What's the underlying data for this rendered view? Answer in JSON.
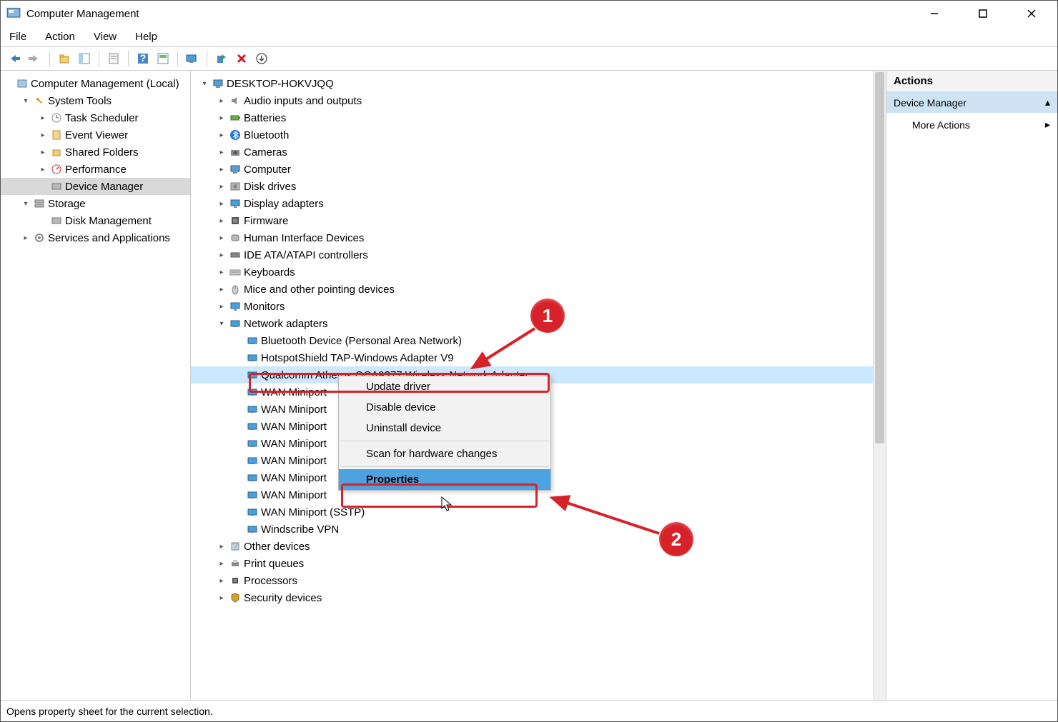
{
  "window": {
    "title": "Computer Management"
  },
  "menubar": [
    "File",
    "Action",
    "View",
    "Help"
  ],
  "left_tree": [
    {
      "indent": 0,
      "exp": "",
      "icon": "mgmt",
      "label": "Computer Management (Local)"
    },
    {
      "indent": 1,
      "exp": "v",
      "icon": "tools",
      "label": "System Tools"
    },
    {
      "indent": 2,
      "exp": ">",
      "icon": "sched",
      "label": "Task Scheduler"
    },
    {
      "indent": 2,
      "exp": ">",
      "icon": "event",
      "label": "Event Viewer"
    },
    {
      "indent": 2,
      "exp": ">",
      "icon": "shared",
      "label": "Shared Folders"
    },
    {
      "indent": 2,
      "exp": ">",
      "icon": "perf",
      "label": "Performance"
    },
    {
      "indent": 2,
      "exp": "",
      "icon": "devmgr",
      "label": "Device Manager",
      "selected": true
    },
    {
      "indent": 1,
      "exp": "v",
      "icon": "storage",
      "label": "Storage"
    },
    {
      "indent": 2,
      "exp": "",
      "icon": "disk",
      "label": "Disk Management"
    },
    {
      "indent": 1,
      "exp": ">",
      "icon": "services",
      "label": "Services and Applications"
    }
  ],
  "center_tree": [
    {
      "indent": 0,
      "exp": "v",
      "icon": "pc",
      "label": "DESKTOP-HOKVJQQ"
    },
    {
      "indent": 1,
      "exp": ">",
      "icon": "audio",
      "label": "Audio inputs and outputs"
    },
    {
      "indent": 1,
      "exp": ">",
      "icon": "battery",
      "label": "Batteries"
    },
    {
      "indent": 1,
      "exp": ">",
      "icon": "bt",
      "label": "Bluetooth"
    },
    {
      "indent": 1,
      "exp": ">",
      "icon": "camera",
      "label": "Cameras"
    },
    {
      "indent": 1,
      "exp": ">",
      "icon": "pc",
      "label": "Computer"
    },
    {
      "indent": 1,
      "exp": ">",
      "icon": "hdd",
      "label": "Disk drives"
    },
    {
      "indent": 1,
      "exp": ">",
      "icon": "display",
      "label": "Display adapters"
    },
    {
      "indent": 1,
      "exp": ">",
      "icon": "fw",
      "label": "Firmware"
    },
    {
      "indent": 1,
      "exp": ">",
      "icon": "hid",
      "label": "Human Interface Devices"
    },
    {
      "indent": 1,
      "exp": ">",
      "icon": "ide",
      "label": "IDE ATA/ATAPI controllers"
    },
    {
      "indent": 1,
      "exp": ">",
      "icon": "kbd",
      "label": "Keyboards"
    },
    {
      "indent": 1,
      "exp": ">",
      "icon": "mouse",
      "label": "Mice and other pointing devices"
    },
    {
      "indent": 1,
      "exp": ">",
      "icon": "display",
      "label": "Monitors"
    },
    {
      "indent": 1,
      "exp": "v",
      "icon": "net",
      "label": "Network adapters"
    },
    {
      "indent": 2,
      "exp": "",
      "icon": "net",
      "label": "Bluetooth Device (Personal Area Network)"
    },
    {
      "indent": 2,
      "exp": "",
      "icon": "net",
      "label": "HotspotShield TAP-Windows Adapter V9"
    },
    {
      "indent": 2,
      "exp": "",
      "icon": "net",
      "label": "Qualcomm Atheros QCA9377 Wireless Network Adapter",
      "hl": true
    },
    {
      "indent": 2,
      "exp": "",
      "icon": "net",
      "label": "WAN Miniport"
    },
    {
      "indent": 2,
      "exp": "",
      "icon": "net",
      "label": "WAN Miniport"
    },
    {
      "indent": 2,
      "exp": "",
      "icon": "net",
      "label": "WAN Miniport"
    },
    {
      "indent": 2,
      "exp": "",
      "icon": "net",
      "label": "WAN Miniport"
    },
    {
      "indent": 2,
      "exp": "",
      "icon": "net",
      "label": "WAN Miniport"
    },
    {
      "indent": 2,
      "exp": "",
      "icon": "net",
      "label": "WAN Miniport"
    },
    {
      "indent": 2,
      "exp": "",
      "icon": "net",
      "label": "WAN Miniport"
    },
    {
      "indent": 2,
      "exp": "",
      "icon": "net",
      "label": "WAN Miniport (SSTP)"
    },
    {
      "indent": 2,
      "exp": "",
      "icon": "net",
      "label": "Windscribe VPN"
    },
    {
      "indent": 1,
      "exp": ">",
      "icon": "other",
      "label": "Other devices"
    },
    {
      "indent": 1,
      "exp": ">",
      "icon": "print",
      "label": "Print queues"
    },
    {
      "indent": 1,
      "exp": ">",
      "icon": "cpu",
      "label": "Processors"
    },
    {
      "indent": 1,
      "exp": ">",
      "icon": "sec",
      "label": "Security devices"
    }
  ],
  "context_menu": {
    "items": [
      {
        "label": "Update driver"
      },
      {
        "label": "Disable device"
      },
      {
        "label": "Uninstall device"
      },
      {
        "sep": true
      },
      {
        "label": "Scan for hardware changes"
      },
      {
        "sep": true
      },
      {
        "label": "Properties",
        "hl": true
      }
    ]
  },
  "actions": {
    "header": "Actions",
    "section": "Device Manager",
    "more": "More Actions"
  },
  "statusbar": "Opens property sheet for the current selection.",
  "annotations": {
    "badge1": "1",
    "badge2": "2"
  }
}
